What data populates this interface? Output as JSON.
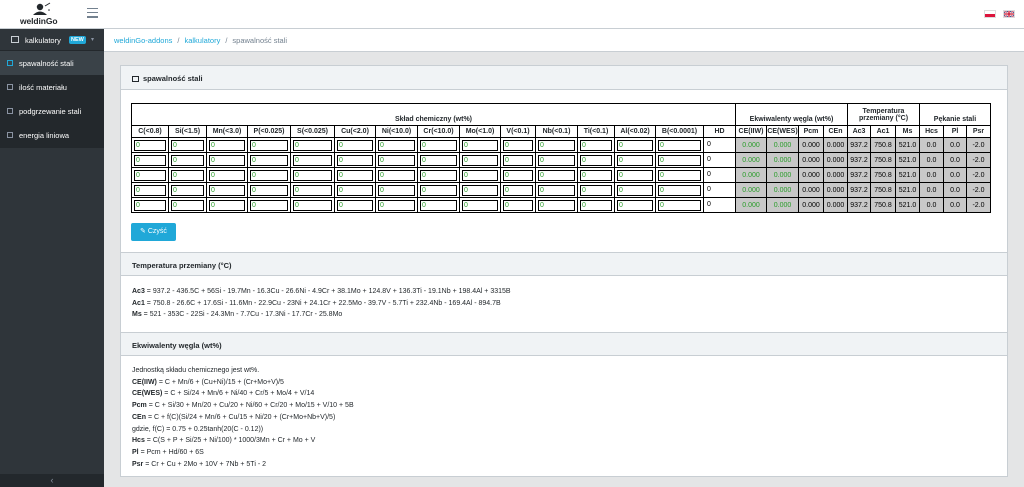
{
  "header": {
    "logo_text": "weldinGo",
    "lang_pl": "PL",
    "lang_en": "EN"
  },
  "sidebar": {
    "section_label": "kalkulatory",
    "section_badge": "NEW",
    "items": [
      {
        "label": "spawalność stali"
      },
      {
        "label": "ilość materiału"
      },
      {
        "label": "podgrzewanie stali"
      },
      {
        "label": "energia liniowa"
      }
    ],
    "collapse_glyph": "‹"
  },
  "breadcrumb": {
    "items": [
      "weldinGo-addons",
      "kalkulatory"
    ],
    "current": "spawalność stali"
  },
  "card": {
    "title": "spawalność stali",
    "groups": {
      "composition": "Skład chemiczny (wt%)",
      "carbon_eq": "Ekwiwalenty węgla (wt%)",
      "temperature": "Temperatura przemiany (°C)",
      "cracking": "Pękanie stali"
    },
    "columns": [
      "C(<0.8)",
      "Si(<1.5)",
      "Mn(<3.0)",
      "P(<0.025)",
      "S(<0.025)",
      "Cu(<2.0)",
      "Ni(<10.0)",
      "Cr(<10.0)",
      "Mo(<1.0)",
      "V(<0.1)",
      "Nb(<0.1)",
      "Ti(<0.1)",
      "Al(<0.02)",
      "B(<0.0001)",
      "HD",
      "CE(IIW)",
      "CE(WES)",
      "Pcm",
      "CEn",
      "Ac3",
      "Ac1",
      "Ms",
      "Hcs",
      "Pl",
      "Psr"
    ],
    "rows": [
      {
        "inputs": [
          "0",
          "0",
          "0",
          "0",
          "0",
          "0",
          "0",
          "0",
          "0",
          "0",
          "0",
          "0",
          "0",
          "0"
        ],
        "hd": "0",
        "ce_iiw": "0.000",
        "ce_wes": "0.000",
        "pcm": "0.000",
        "cen": "0.000",
        "ac3": "937.2",
        "ac1": "750.8",
        "ms": "521.0",
        "hcs": "0.0",
        "pl": "0.0",
        "psr": "-2.0"
      },
      {
        "inputs": [
          "0",
          "0",
          "0",
          "0",
          "0",
          "0",
          "0",
          "0",
          "0",
          "0",
          "0",
          "0",
          "0",
          "0"
        ],
        "hd": "0",
        "ce_iiw": "0.000",
        "ce_wes": "0.000",
        "pcm": "0.000",
        "cen": "0.000",
        "ac3": "937.2",
        "ac1": "750.8",
        "ms": "521.0",
        "hcs": "0.0",
        "pl": "0.0",
        "psr": "-2.0"
      },
      {
        "inputs": [
          "0",
          "0",
          "0",
          "0",
          "0",
          "0",
          "0",
          "0",
          "0",
          "0",
          "0",
          "0",
          "0",
          "0"
        ],
        "hd": "0",
        "ce_iiw": "0.000",
        "ce_wes": "0.000",
        "pcm": "0.000",
        "cen": "0.000",
        "ac3": "937.2",
        "ac1": "750.8",
        "ms": "521.0",
        "hcs": "0.0",
        "pl": "0.0",
        "psr": "-2.0"
      },
      {
        "inputs": [
          "0",
          "0",
          "0",
          "0",
          "0",
          "0",
          "0",
          "0",
          "0",
          "0",
          "0",
          "0",
          "0",
          "0"
        ],
        "hd": "0",
        "ce_iiw": "0.000",
        "ce_wes": "0.000",
        "pcm": "0.000",
        "cen": "0.000",
        "ac3": "937.2",
        "ac1": "750.8",
        "ms": "521.0",
        "hcs": "0.0",
        "pl": "0.0",
        "psr": "-2.0"
      },
      {
        "inputs": [
          "0",
          "0",
          "0",
          "0",
          "0",
          "0",
          "0",
          "0",
          "0",
          "0",
          "0",
          "0",
          "0",
          "0"
        ],
        "hd": "0",
        "ce_iiw": "0.000",
        "ce_wes": "0.000",
        "pcm": "0.000",
        "cen": "0.000",
        "ac3": "937.2",
        "ac1": "750.8",
        "ms": "521.0",
        "hcs": "0.0",
        "pl": "0.0",
        "psr": "-2.0"
      }
    ],
    "clear_button": "Czyść"
  },
  "temperature_section": {
    "title": "Temperatura przemiany (°C)",
    "lines": [
      {
        "label": "Ac3",
        "text": " = 937.2 - 436.5C + 56Si - 19.7Mn - 16.3Cu - 26.6Ni - 4.9Cr + 38.1Mo + 124.8V + 136.3Ti - 19.1Nb + 198.4Al + 3315B"
      },
      {
        "label": "Ac1",
        "text": " = 750.8 - 26.6C + 17.6Si - 11.6Mn - 22.9Cu - 23Ni + 24.1Cr + 22.5Mo - 39.7V - 5.7Ti + 232.4Nb - 169.4Al - 894.7B"
      },
      {
        "label": "Ms",
        "text": " = 521 - 353C - 22Si - 24.3Mn - 7.7Cu - 17.3Ni - 17.7Cr - 25.8Mo"
      }
    ]
  },
  "carbon_section": {
    "title": "Ekwiwalenty węgla (wt%)",
    "lines": [
      {
        "label": "",
        "text": "Jednostką składu chemicznego jest wt%."
      },
      {
        "label": "CE(IIW)",
        "text": " = C + Mn/6 + (Cu+Ni)/15 + (Cr+Mo+V)/5"
      },
      {
        "label": "CE(WES)",
        "text": " = C + Si/24 + Mn/6 + Ni/40 + Cr/5 + Mo/4 + V/14"
      },
      {
        "label": "Pcm",
        "text": " = C + Si/30 + Mn/20 + Cu/20 + Ni/60 + Cr/20 + Mo/15 + V/10 + 5B"
      },
      {
        "label": "CEn",
        "text": " = C + f(C)(Si/24 + Mn/6 + Cu/15 + Ni/20 + (Cr+Mo+Nb+V)/5)"
      },
      {
        "label": "",
        "text": "gdzie, f(C) = 0.75 + 0.25tanh(20(C - 0.12))"
      },
      {
        "label": "Hcs",
        "text": " = C(S + P + Si/25 + Ni/100) * 1000/3Mn + Cr + Mo + V"
      },
      {
        "label": "Pl",
        "text": " = Pcm + Hd/60 + 6S"
      },
      {
        "label": "Psr",
        "text": " = Cr + Cu + 2Mo + 10V + 7Nb + 5Ti - 2"
      }
    ]
  }
}
